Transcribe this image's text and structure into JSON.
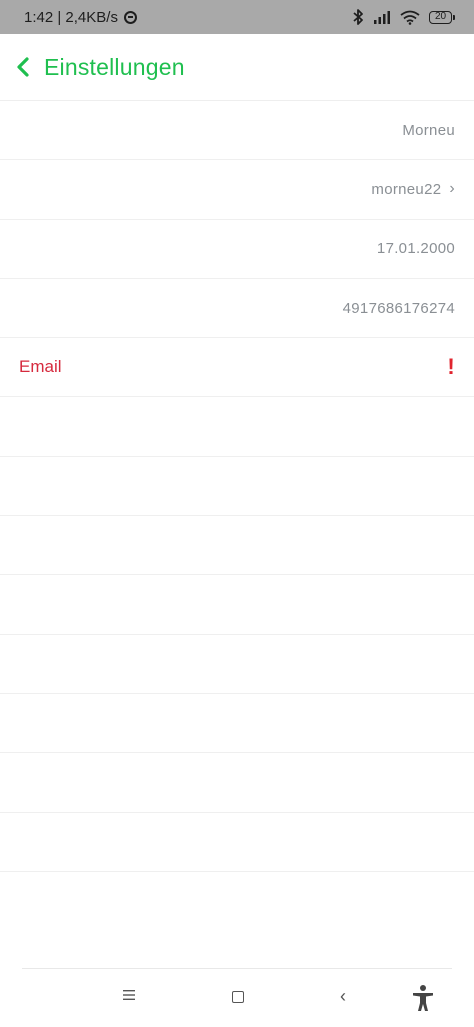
{
  "status_bar": {
    "time_speed": "1:42 | 2,4KB/s",
    "battery": "20"
  },
  "header": {
    "title": "Einstellungen"
  },
  "rows": [
    {
      "label": "",
      "value": "Morneu"
    },
    {
      "label": "",
      "value": "morneu22"
    },
    {
      "label": "",
      "value": "17.01.2000"
    },
    {
      "label": "",
      "value": "4917686176274"
    },
    {
      "label": "Email",
      "value": ""
    }
  ],
  "colors": {
    "accent": "#1fbf4f",
    "alert": "#d62a3e",
    "status_bar": "#a9a9a9"
  },
  "icons": [
    "back-chevron-icon",
    "chevron-right-icon",
    "exclamation-icon",
    "do-not-disturb-icon",
    "bluetooth-icon",
    "signal-icon",
    "wifi-icon",
    "battery-icon",
    "menu-icon",
    "home-icon",
    "back-icon",
    "accessibility-icon"
  ]
}
